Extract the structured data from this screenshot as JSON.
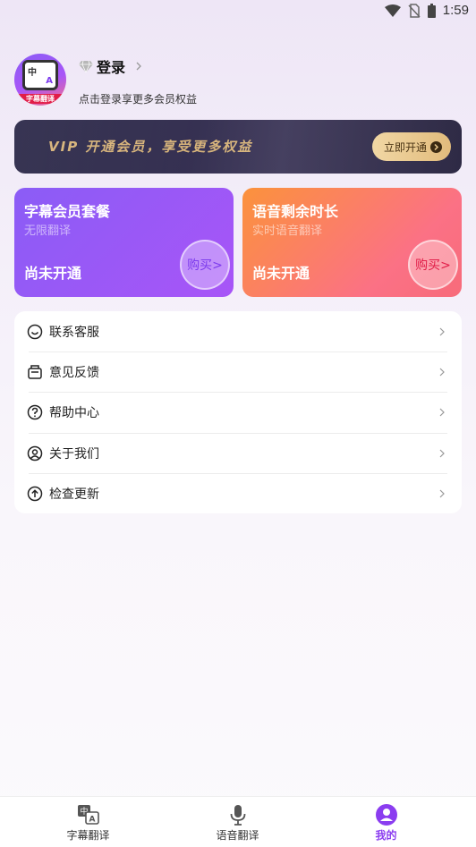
{
  "status_bar": {
    "time": "1:59"
  },
  "profile": {
    "login_label": "登录",
    "subtitle": "点击登录享更多会员权益",
    "avatar_glyph_1": "中",
    "avatar_glyph_2": "A",
    "avatar_caption": "字幕翻译"
  },
  "vip_banner": {
    "text": "VIP 开通会员，享受更多权益",
    "button_label": "立即开通"
  },
  "cards": [
    {
      "title": "字幕会员套餐",
      "subtitle": "无限翻译",
      "status": "尚未开通",
      "buy_label": "购买>"
    },
    {
      "title": "语音剩余时长",
      "subtitle": "实时语音翻译",
      "status": "尚未开通",
      "buy_label": "购买>"
    }
  ],
  "menu": {
    "items": [
      {
        "label": "联系客服",
        "icon": "customer-service-icon"
      },
      {
        "label": "意见反馈",
        "icon": "feedback-icon"
      },
      {
        "label": "帮助中心",
        "icon": "help-icon"
      },
      {
        "label": "关于我们",
        "icon": "about-icon"
      },
      {
        "label": "检查更新",
        "icon": "update-icon"
      }
    ]
  },
  "bottom_nav": {
    "items": [
      {
        "label": "字幕翻译",
        "icon": "subtitle-translate-icon",
        "active": false
      },
      {
        "label": "语音翻译",
        "icon": "microphone-icon",
        "active": false
      },
      {
        "label": "我的",
        "icon": "profile-icon",
        "active": true
      }
    ]
  },
  "colors": {
    "accent": "#8b3df0",
    "vip_gold": "#d6b37a",
    "card_purple": "#a855f7",
    "card_orange": "#fb7185"
  }
}
